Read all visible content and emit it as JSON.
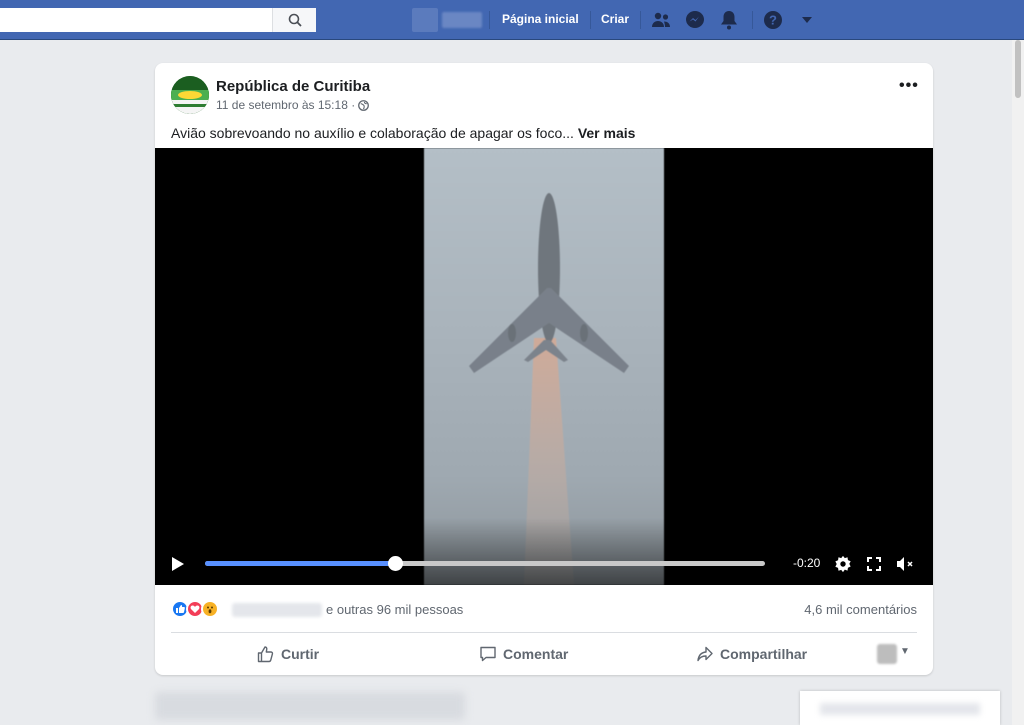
{
  "topbar": {
    "search_placeholder": "",
    "nav": {
      "home_label": "Página inicial",
      "create_label": "Criar"
    },
    "icons": [
      "friends-icon",
      "messenger-icon",
      "bell-icon",
      "help-icon",
      "caret-down-icon"
    ]
  },
  "post": {
    "page_name": "República de Curitiba",
    "date": "11 de setembro às 15:18 ·",
    "text": "Avião sobrevoando no auxílio e colaboração de apagar os foco...",
    "see_more": "Ver mais",
    "video": {
      "time_remaining": "-0:20",
      "progress": 0.34
    },
    "reactions": {
      "types": [
        "like",
        "love",
        "wow"
      ],
      "others_text": "e outras 96 mil pessoas",
      "comments_text": "4,6 mil comentários"
    },
    "actions": {
      "like": "Curtir",
      "comment": "Comentar",
      "share": "Compartilhar"
    }
  },
  "colors": {
    "brand": "#4267b2",
    "progress": "#5890ff",
    "like": "#1877f2",
    "love": "#f33e58",
    "wow": "#f7b125"
  }
}
